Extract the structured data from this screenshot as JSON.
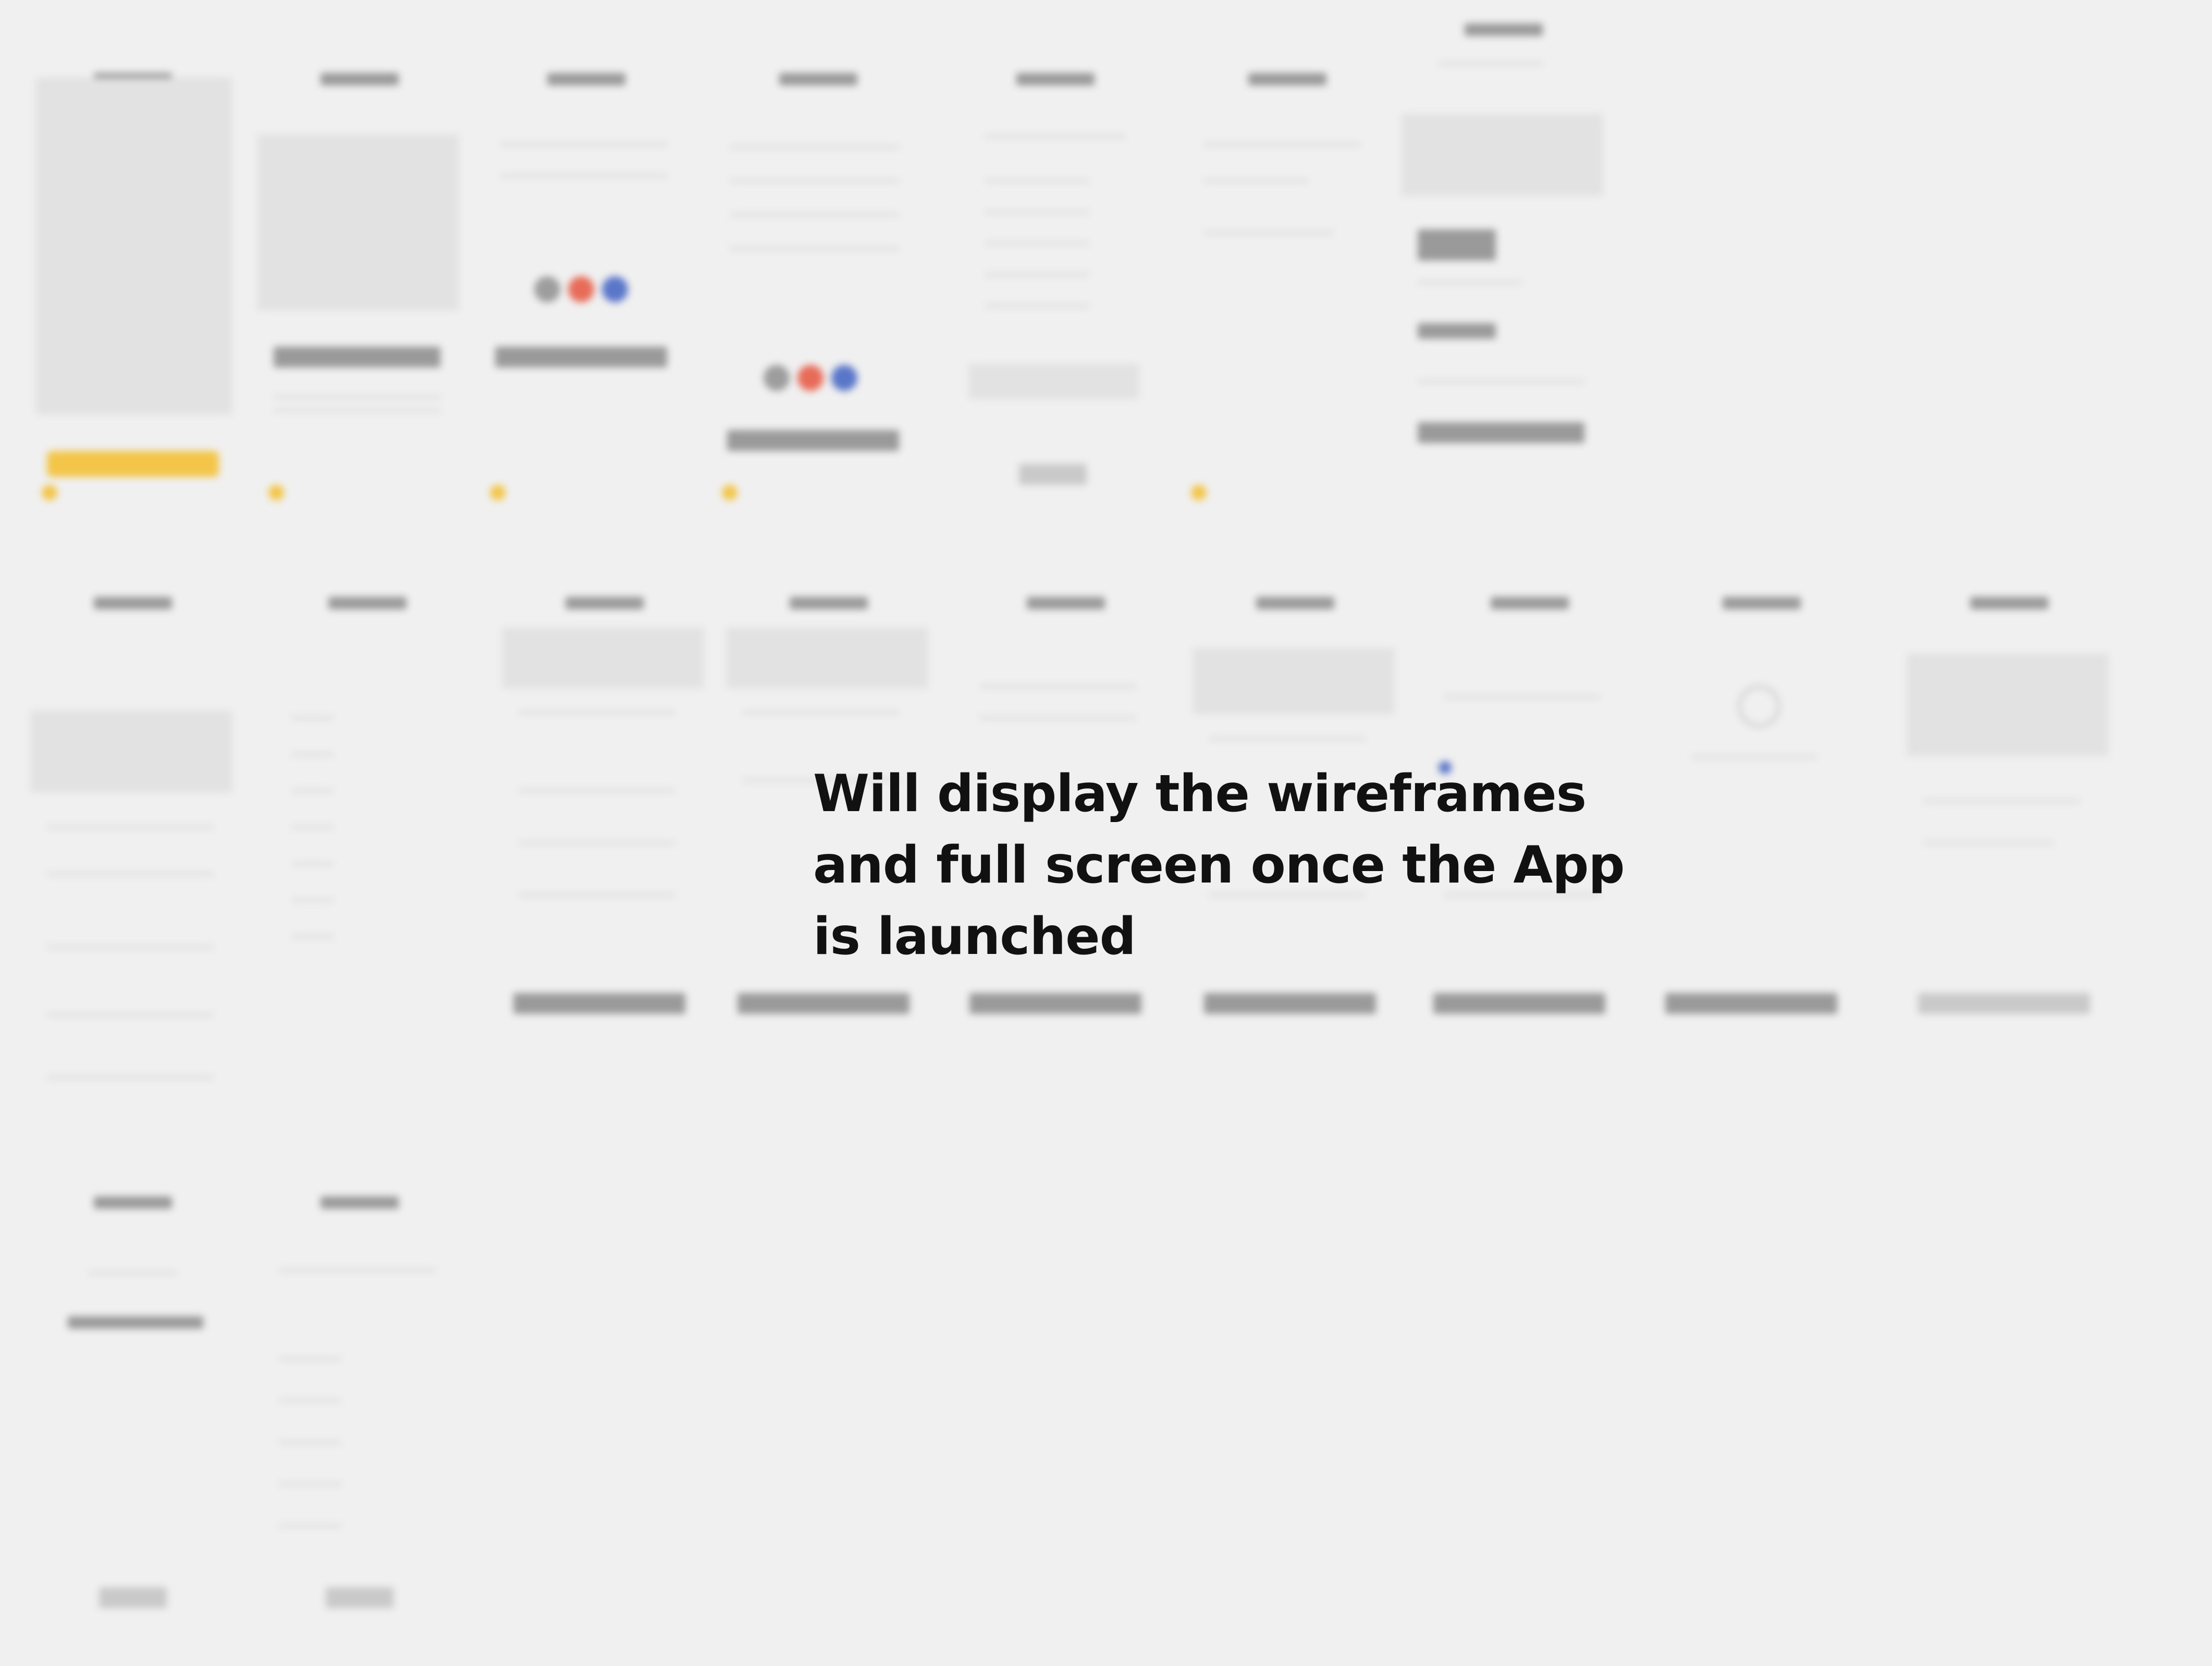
{
  "caption": {
    "text": "Will display the wireframes and full screen once the App is launched"
  },
  "colors": {
    "background": "#f0f0f0",
    "caption_text": "#111111",
    "wireframe_accent": "#f3c548",
    "wireframe_gray": "#b3b3b3"
  }
}
